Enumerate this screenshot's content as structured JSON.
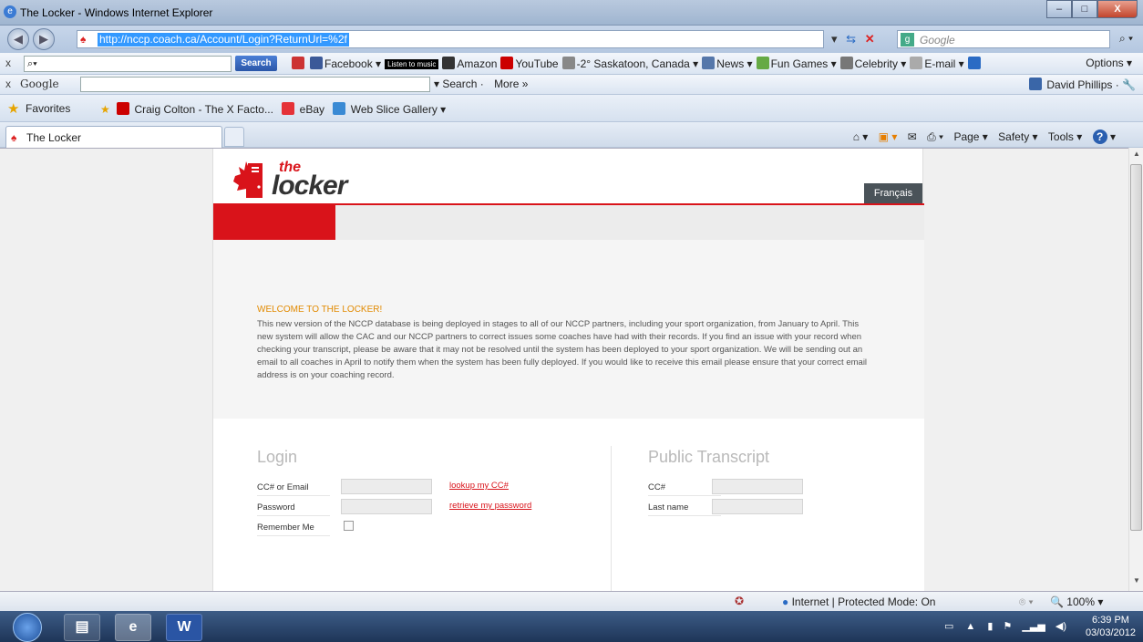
{
  "window": {
    "title": "The Locker - Windows Internet Explorer",
    "minimize": "–",
    "maximize": "□",
    "close": "X"
  },
  "address_bar": {
    "url": "http://nccp.coach.ca/Account/Login?ReturnUrl=%2f",
    "search_placeholder": "Google"
  },
  "ask_toolbar": {
    "search_button": "Search",
    "items": [
      "Facebook ▾",
      "Listen to music",
      "Amazon",
      "YouTube",
      "-2° Saskatoon, Canada ▾",
      "News ▾",
      "Fun Games ▾",
      "Celebrity ▾",
      "E-mail ▾"
    ],
    "options": "Options ▾"
  },
  "google_toolbar": {
    "label": "Google",
    "search": "Search ·",
    "more": "More »",
    "user": "David Phillips ·"
  },
  "favorites_bar": {
    "label": "Favorites",
    "items": [
      "Craig Colton - The X Facto...",
      "eBay",
      "Web Slice Gallery ▾"
    ]
  },
  "tab": {
    "title": "The Locker"
  },
  "command_bar": {
    "page": "Page ▾",
    "safety": "Safety ▾",
    "tools": "Tools ▾"
  },
  "site": {
    "logo_the": "the",
    "logo_locker": "locker",
    "language_button": "Français",
    "welcome_title": "WELCOME TO THE LOCKER!",
    "welcome_text": "This new version of the NCCP database is being deployed in stages to all of our NCCP partners, including your sport organization, from January to April. This new system will allow the CAC and our NCCP partners to correct issues some coaches have had with their records. If you find an issue with your record when checking your transcript, please be aware that it may not be resolved until the system has been deployed to your sport organization. We will be sending out an email to all coaches in April to notify them when the system has been fully deployed. If you would like to receive this email please ensure that your correct email address is on your coaching record.",
    "login": {
      "heading": "Login",
      "cc_label": "CC# or Email",
      "password_label": "Password",
      "remember_label": "Remember Me",
      "lookup_link": "lookup my CC#",
      "retrieve_link": "retrieve my password"
    },
    "transcript": {
      "heading": "Public Transcript",
      "cc_label": "CC#",
      "lastname_label": "Last name"
    }
  },
  "status_bar": {
    "zone": "Internet | Protected Mode: On",
    "zoom": "100%"
  },
  "taskbar": {
    "time": "6:39 PM",
    "date": "03/03/2012"
  }
}
